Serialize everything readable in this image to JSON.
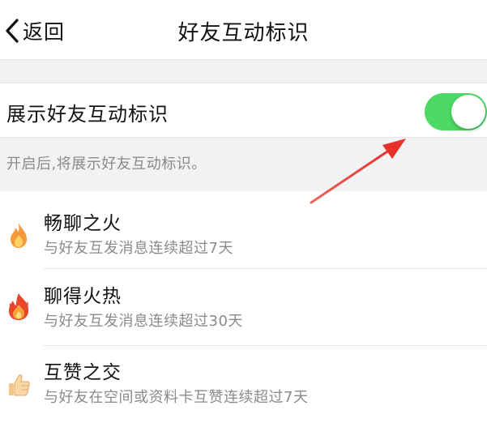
{
  "nav": {
    "back_label": "返回",
    "title": "好友互动标识"
  },
  "setting": {
    "label": "展示好友互动标识",
    "enabled": true,
    "hint": "开启后,将展示好友互动标识。"
  },
  "colors": {
    "toggle_on": "#4cd964",
    "arrow": "#e8312a",
    "secondary_text": "#8a8a8a",
    "background_gray": "#f2f2f4"
  },
  "items": [
    {
      "title": "畅聊之火",
      "desc": "与好友互发消息连续超过7天",
      "icon": "small-flame-icon"
    },
    {
      "title": "聊得火热",
      "desc": "与好友互发消息连续超过30天",
      "icon": "big-flame-icon"
    },
    {
      "title": "互赞之交",
      "desc": "与好友在空间或资料卡互赞连续超过7天",
      "icon": "thumbs-up-icon"
    }
  ]
}
